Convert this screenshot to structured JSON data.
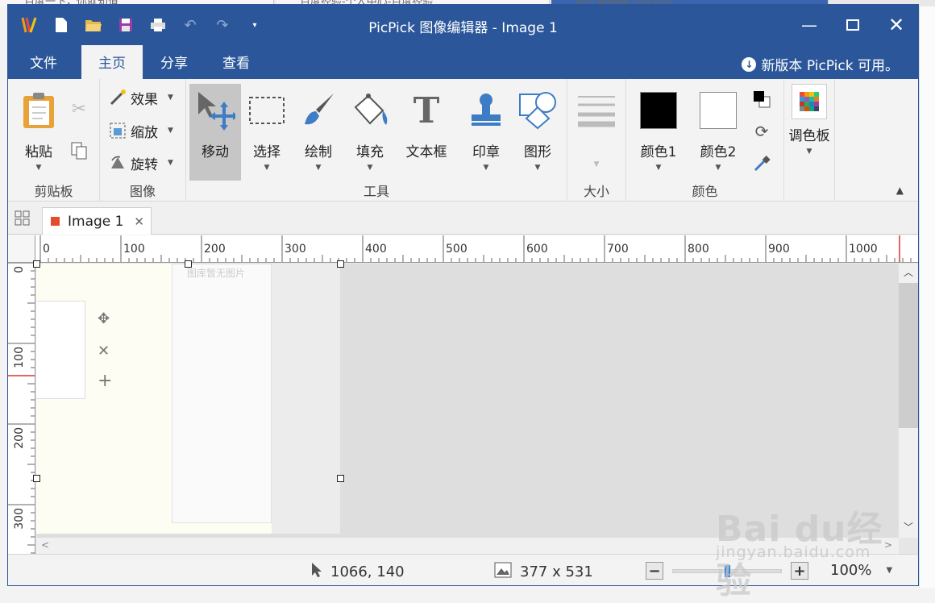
{
  "background_tabs": [
    {
      "label": "百度一下，你就知道"
    },
    {
      "label": "百度经验-个人中心-百度经验"
    },
    {
      "label": "图片编辑器-百度经验"
    }
  ],
  "window": {
    "title": "PicPick 图像编辑器 - Image 1",
    "accent": "#2b579a"
  },
  "qat": [
    "logo-icon",
    "new-icon",
    "open-icon",
    "save-icon",
    "print-icon",
    "undo-icon",
    "redo-icon",
    "customize-icon"
  ],
  "menu": {
    "tabs": [
      "文件",
      "主页",
      "分享",
      "查看"
    ],
    "active": "主页",
    "update_text": "新版本 PicPick 可用。"
  },
  "ribbon": {
    "clipboard": {
      "label": "剪贴板",
      "paste": "粘贴"
    },
    "image": {
      "label": "图像",
      "effects": "效果",
      "resize": "缩放",
      "rotate": "旋转"
    },
    "tools": {
      "label": "工具",
      "move": "移动",
      "select": "选择",
      "draw": "绘制",
      "fill": "填充",
      "textbox": "文本框",
      "stamp": "印章",
      "shape": "图形"
    },
    "size": {
      "label": "大小"
    },
    "colors": {
      "label": "颜色",
      "color1": "颜色1",
      "color2": "颜色2",
      "palette": "调色板",
      "color1_value": "#000000",
      "color2_value": "#ffffff"
    }
  },
  "doc_tab": {
    "name": "Image 1"
  },
  "ruler": {
    "h_labels": [
      "0",
      "100",
      "200",
      "300",
      "400",
      "500",
      "600",
      "700",
      "800",
      "900",
      "1000"
    ],
    "v_labels": [
      "0",
      "100",
      "200",
      "300"
    ]
  },
  "canvas": {
    "caption": "图库暂无图片"
  },
  "status": {
    "cursor": "1066, 140",
    "image_size": "377 x 531",
    "zoom": "100%",
    "zoom_fraction": 0.5
  },
  "watermark": {
    "line1": "Bai du经验",
    "line2": "jingyan.baidu.com"
  }
}
